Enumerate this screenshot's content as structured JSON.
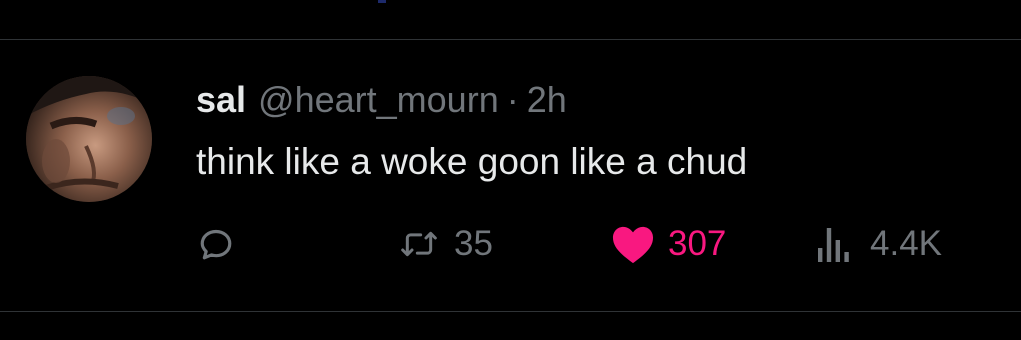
{
  "tweet": {
    "display_name": "sal",
    "handle": "@heart_mourn",
    "separator": "·",
    "time": "2h",
    "text": "think like a woke goon like a chud"
  },
  "actions": {
    "reply": {
      "icon": "reply-icon"
    },
    "retweet": {
      "icon": "retweet-icon",
      "count": "35"
    },
    "like": {
      "icon": "heart-icon",
      "count": "307",
      "liked": true
    },
    "views": {
      "icon": "views-icon",
      "count": "4.4K"
    }
  },
  "colors": {
    "background": "#000000",
    "primary_text": "#e7e9ea",
    "secondary_text": "#71767b",
    "like": "#f91880",
    "divider": "#2f3336"
  }
}
